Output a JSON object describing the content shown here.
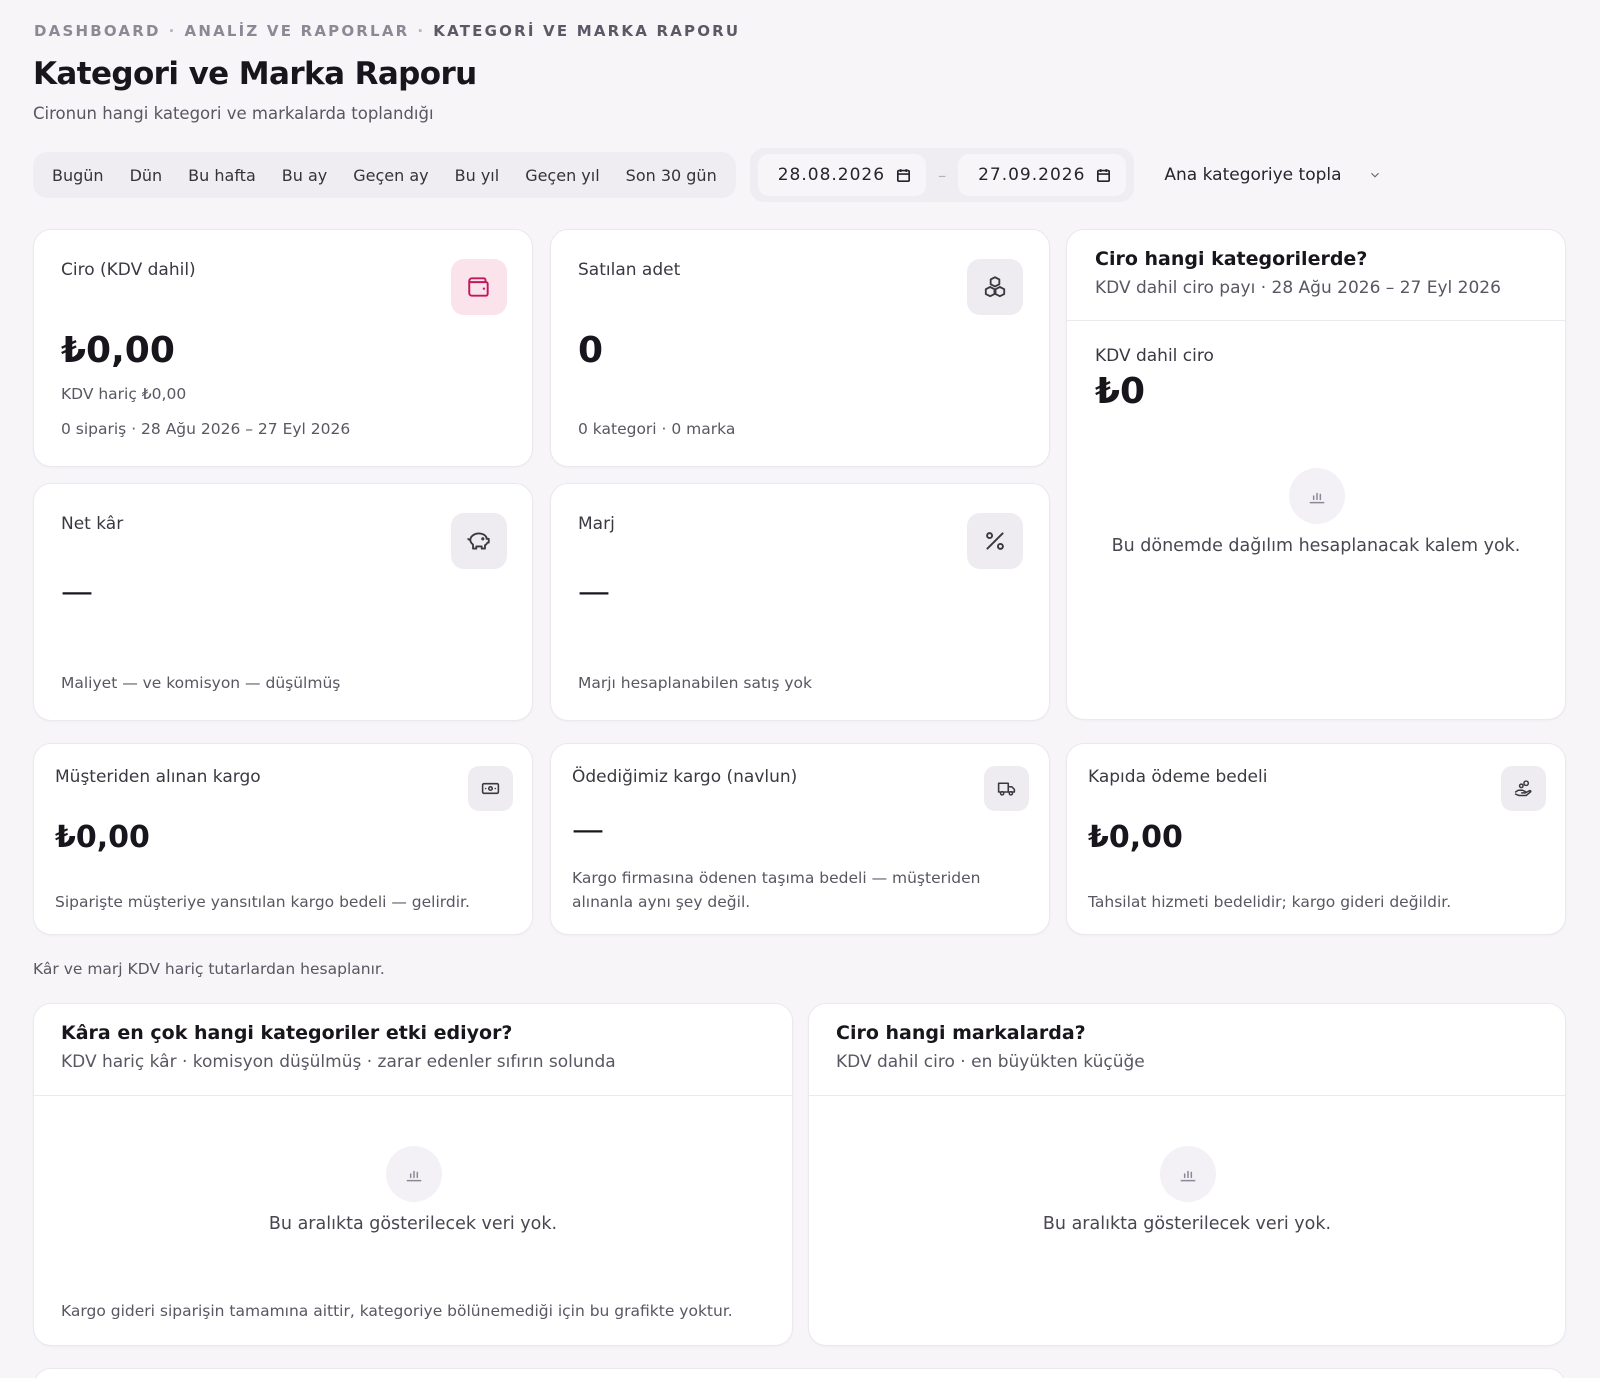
{
  "breadcrumb": {
    "items": [
      "DASHBOARD",
      "ANALİZ VE RAPORLAR",
      "KATEGORİ VE MARKA RAPORU"
    ],
    "separator": "·"
  },
  "page": {
    "title": "Kategori ve Marka Raporu",
    "subtitle": "Cironun hangi kategori ve markalarda toplandığı"
  },
  "filters": {
    "presets": [
      "Bugün",
      "Dün",
      "Bu hafta",
      "Bu ay",
      "Geçen ay",
      "Bu yıl",
      "Geçen yıl",
      "Son 30 gün"
    ],
    "date_from": "28.08.2026",
    "date_separator": "–",
    "date_to": "27.09.2026",
    "grouping": "Ana kategoriye topla"
  },
  "cards": {
    "revenue": {
      "label": "Ciro (KDV dahil)",
      "value": "₺0,00",
      "sub1": "KDV hariç ₺0,00",
      "sub2": "0 sipariş · 28 Ağu 2026 – 27 Eyl 2026",
      "icon": "wallet-icon"
    },
    "units": {
      "label": "Satılan adet",
      "value": "0",
      "sub": "0 kategori · 0 marka",
      "icon": "boxes-icon"
    },
    "net_profit": {
      "label": "Net kâr",
      "value": "—",
      "sub": "Maliyet — ve komisyon — düşülmüş",
      "icon": "piggy-bank-icon"
    },
    "margin": {
      "label": "Marj",
      "value": "—",
      "sub": "Marjı hesaplanabilen satış yok",
      "icon": "percent-icon"
    },
    "customer_shipping": {
      "label": "Müşteriden alınan kargo",
      "value": "₺0,00",
      "sub": "Siparişte müşteriye yansıtılan kargo bedeli — gelirdir.",
      "icon": "banknote-icon"
    },
    "paid_shipping": {
      "label": "Ödediğimiz kargo (navlun)",
      "value": "—",
      "sub1": "Kargo firmasına ödenen taşıma bedeli — müşteriden",
      "sub2": "alınanla aynı şey değil.",
      "icon": "truck-icon"
    },
    "cod_fee": {
      "label": "Kapıda ödeme bedeli",
      "value": "₺0,00",
      "sub": "Tahsilat hizmeti bedelidir; kargo gideri değildir.",
      "icon": "hand-coins-icon"
    }
  },
  "category_share": {
    "title": "Ciro hangi kategorilerde?",
    "subtitle": "KDV dahil ciro payı · 28 Ağu 2026 – 27 Eyl 2026",
    "metric_label": "KDV dahil ciro",
    "metric_value": "₺0",
    "empty_text": "Bu dönemde dağılım hesaplanacak kalem yok."
  },
  "note": "Kâr ve marj KDV hariç tutarlardan hesaplanır.",
  "profit_panel": {
    "title": "Kâra en çok hangi kategoriler etki ediyor?",
    "subtitle": "KDV hariç kâr · komisyon düşülmüş · zarar edenler sıfırın solunda",
    "empty_text": "Bu aralıkta gösterilecek veri yok.",
    "footnote": "Kargo gideri siparişin tamamına aittir, kategoriye bölünemediği için bu grafikte yoktur."
  },
  "brand_panel": {
    "title": "Ciro hangi markalarda?",
    "subtitle": "KDV dahil ciro · en büyükten küçüğe",
    "empty_text": "Bu aralıkta gösterilecek veri yok."
  },
  "colors": {
    "background": "#f7f5f8",
    "card": "#ffffff",
    "accent_pink": "#c2185b",
    "accent_pink_bg": "#fbe3ec"
  }
}
